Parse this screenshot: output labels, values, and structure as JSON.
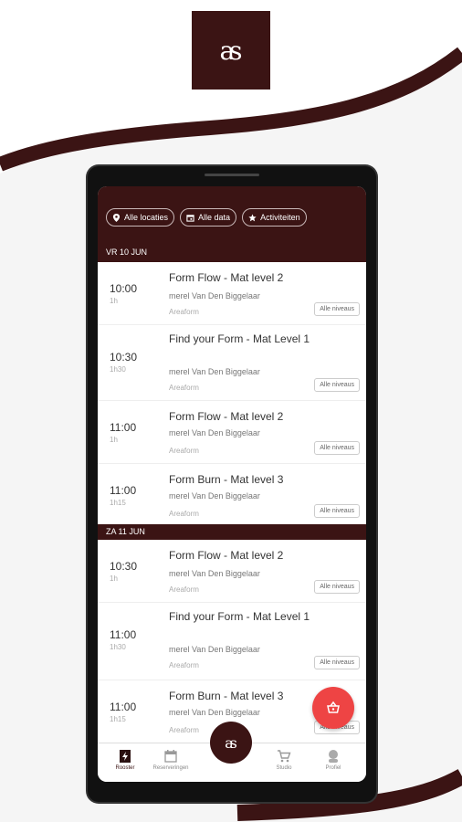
{
  "logo": {
    "text": "as"
  },
  "filters": [
    {
      "label": "Alle locaties",
      "icon": "map-pin-icon"
    },
    {
      "label": "Alle data",
      "icon": "calendar-icon"
    },
    {
      "label": "Activiteiten",
      "icon": "star-icon"
    }
  ],
  "days": [
    {
      "header": "VR 10 JUN",
      "classes": [
        {
          "time": "10:00",
          "duration": "1h",
          "title": "Form Flow - Mat level 2",
          "teacher": "merel Van Den Biggelaar",
          "location": "Areaform",
          "level": "Alle niveaus"
        },
        {
          "time": "10:30",
          "duration": "1h30",
          "title": "Find your Form - Mat Level 1",
          "teacher": "merel Van Den Biggelaar",
          "location": "Areaform",
          "level": "Alle niveaus"
        },
        {
          "time": "11:00",
          "duration": "1h",
          "title": "Form Flow - Mat level 2",
          "teacher": "merel Van Den Biggelaar",
          "location": "Areaform",
          "level": "Alle niveaus"
        },
        {
          "time": "11:00",
          "duration": "1h15",
          "title": "Form Burn - Mat level 3",
          "teacher": "merel Van Den Biggelaar",
          "location": "Areaform",
          "level": "Alle niveaus"
        }
      ]
    },
    {
      "header": "ZA 11 JUN",
      "classes": [
        {
          "time": "10:30",
          "duration": "1h",
          "title": "Form Flow - Mat level 2",
          "teacher": "merel Van Den Biggelaar",
          "location": "Areaform",
          "level": "Alle niveaus"
        },
        {
          "time": "11:00",
          "duration": "1h30",
          "title": "Find your Form - Mat Level 1",
          "teacher": "merel Van Den Biggelaar",
          "location": "Areaform",
          "level": "Alle niveaus"
        },
        {
          "time": "11:00",
          "duration": "1h15",
          "title": "Form Burn - Mat level 3",
          "teacher": "merel Van Den Biggelaar",
          "location": "Areaform",
          "level": "Alle niveaus"
        }
      ]
    }
  ],
  "tabs": [
    {
      "label": "Rooster",
      "icon": "schedule-icon"
    },
    {
      "label": "Reserveringen",
      "icon": "calendar-icon"
    },
    {
      "label": "Studio",
      "icon": "cart-icon"
    },
    {
      "label": "Profiel",
      "icon": "profile-icon"
    }
  ],
  "colors": {
    "brand": "#3b1414",
    "cart_fab": "#ee4444"
  }
}
